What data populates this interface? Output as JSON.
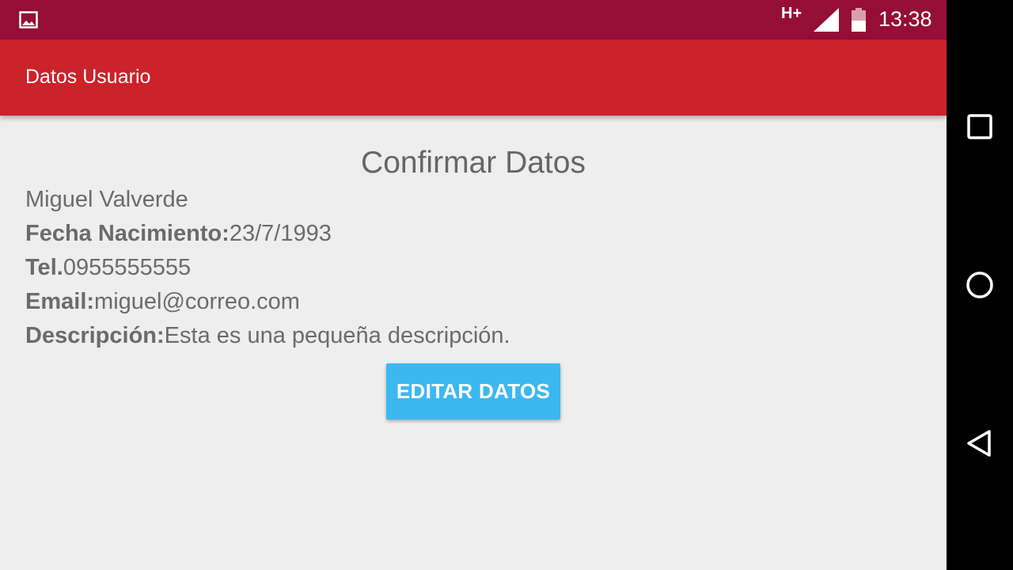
{
  "status_bar": {
    "network_type": "H+",
    "time": "13:38",
    "icons": [
      "image-notification-icon",
      "signal-icon",
      "battery-icon"
    ]
  },
  "app_bar": {
    "title": "Datos Usuario"
  },
  "content": {
    "heading": "Confirmar Datos",
    "name": "Miguel Valverde",
    "fields": [
      {
        "label": "Fecha Nacimiento:",
        "value": "23/7/1993"
      },
      {
        "label": "Tel.",
        "value": "0955555555"
      },
      {
        "label": "Email:",
        "value": "miguel@correo.com"
      },
      {
        "label": "Descripción:",
        "value": "Esta es una pequeña descripción."
      }
    ],
    "edit_button_label": "EDITAR DATOS"
  },
  "nav_bar": {
    "buttons": [
      "recents-icon",
      "home-icon",
      "back-icon"
    ]
  },
  "colors": {
    "status_bar": "#940e35",
    "app_bar": "#cc222a",
    "button": "#3cb8f0",
    "background": "#eeeeee"
  }
}
